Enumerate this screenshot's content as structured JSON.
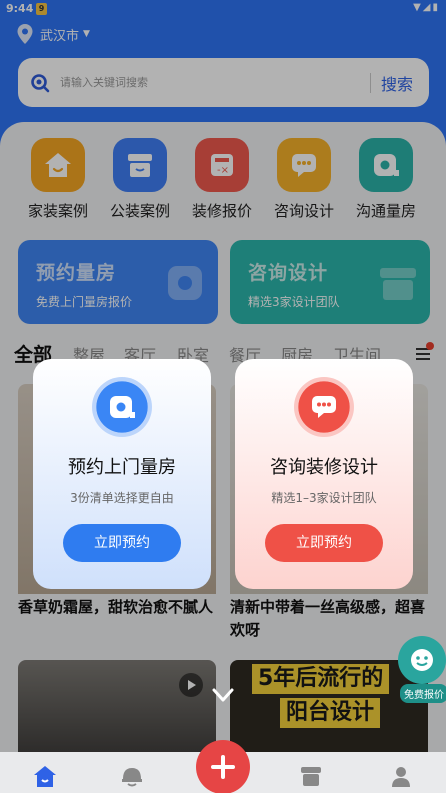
{
  "status_bar": {
    "time": "9:44",
    "notif_badge": "9"
  },
  "location": {
    "city": "武汉市"
  },
  "search": {
    "placeholder": "请输入关键词搜索",
    "button": "搜索"
  },
  "categories": [
    {
      "label": "家装案例",
      "icon": "house-icon",
      "color": "#f5a623"
    },
    {
      "label": "公装案例",
      "icon": "store-icon",
      "color": "#3f7ef5"
    },
    {
      "label": "装修报价",
      "icon": "calculator-icon",
      "color": "#ef5a4e"
    },
    {
      "label": "咨询设计",
      "icon": "chat-icon",
      "color": "#f6b22a"
    },
    {
      "label": "沟通量房",
      "icon": "tape-measure-icon",
      "color": "#2bb3a9"
    }
  ],
  "banners": [
    {
      "title": "预约量房",
      "subtitle": "免费上门量房报价",
      "color": "#3f86f4"
    },
    {
      "title": "咨询设计",
      "subtitle": "精选3家设计团队",
      "color": "#2cb6ac"
    }
  ],
  "tabs": [
    "全部",
    "整屋",
    "客厅",
    "卧室",
    "餐厅",
    "厨房",
    "卫生间"
  ],
  "articles": [
    {
      "title": "香草奶霜屋，甜软治愈不腻人"
    },
    {
      "title": "清新中带着一丝高级感，超喜欢呀"
    },
    {
      "title": ""
    },
    {
      "title": "5年后流行的阳台设计"
    }
  ],
  "popups": [
    {
      "title": "预约上门量房",
      "subtitle": "3份清单选择更自由",
      "button": "立即预约",
      "accent": "#2f7cf0"
    },
    {
      "title": "咨询装修设计",
      "subtitle": "精选1–3家设计团队",
      "button": "立即预约",
      "accent": "#ef5147"
    }
  ],
  "float_button": {
    "label": "免费报价"
  },
  "nav": {
    "items": [
      "home-icon",
      "helmet-icon",
      "add-icon",
      "store-icon",
      "profile-icon"
    ]
  }
}
